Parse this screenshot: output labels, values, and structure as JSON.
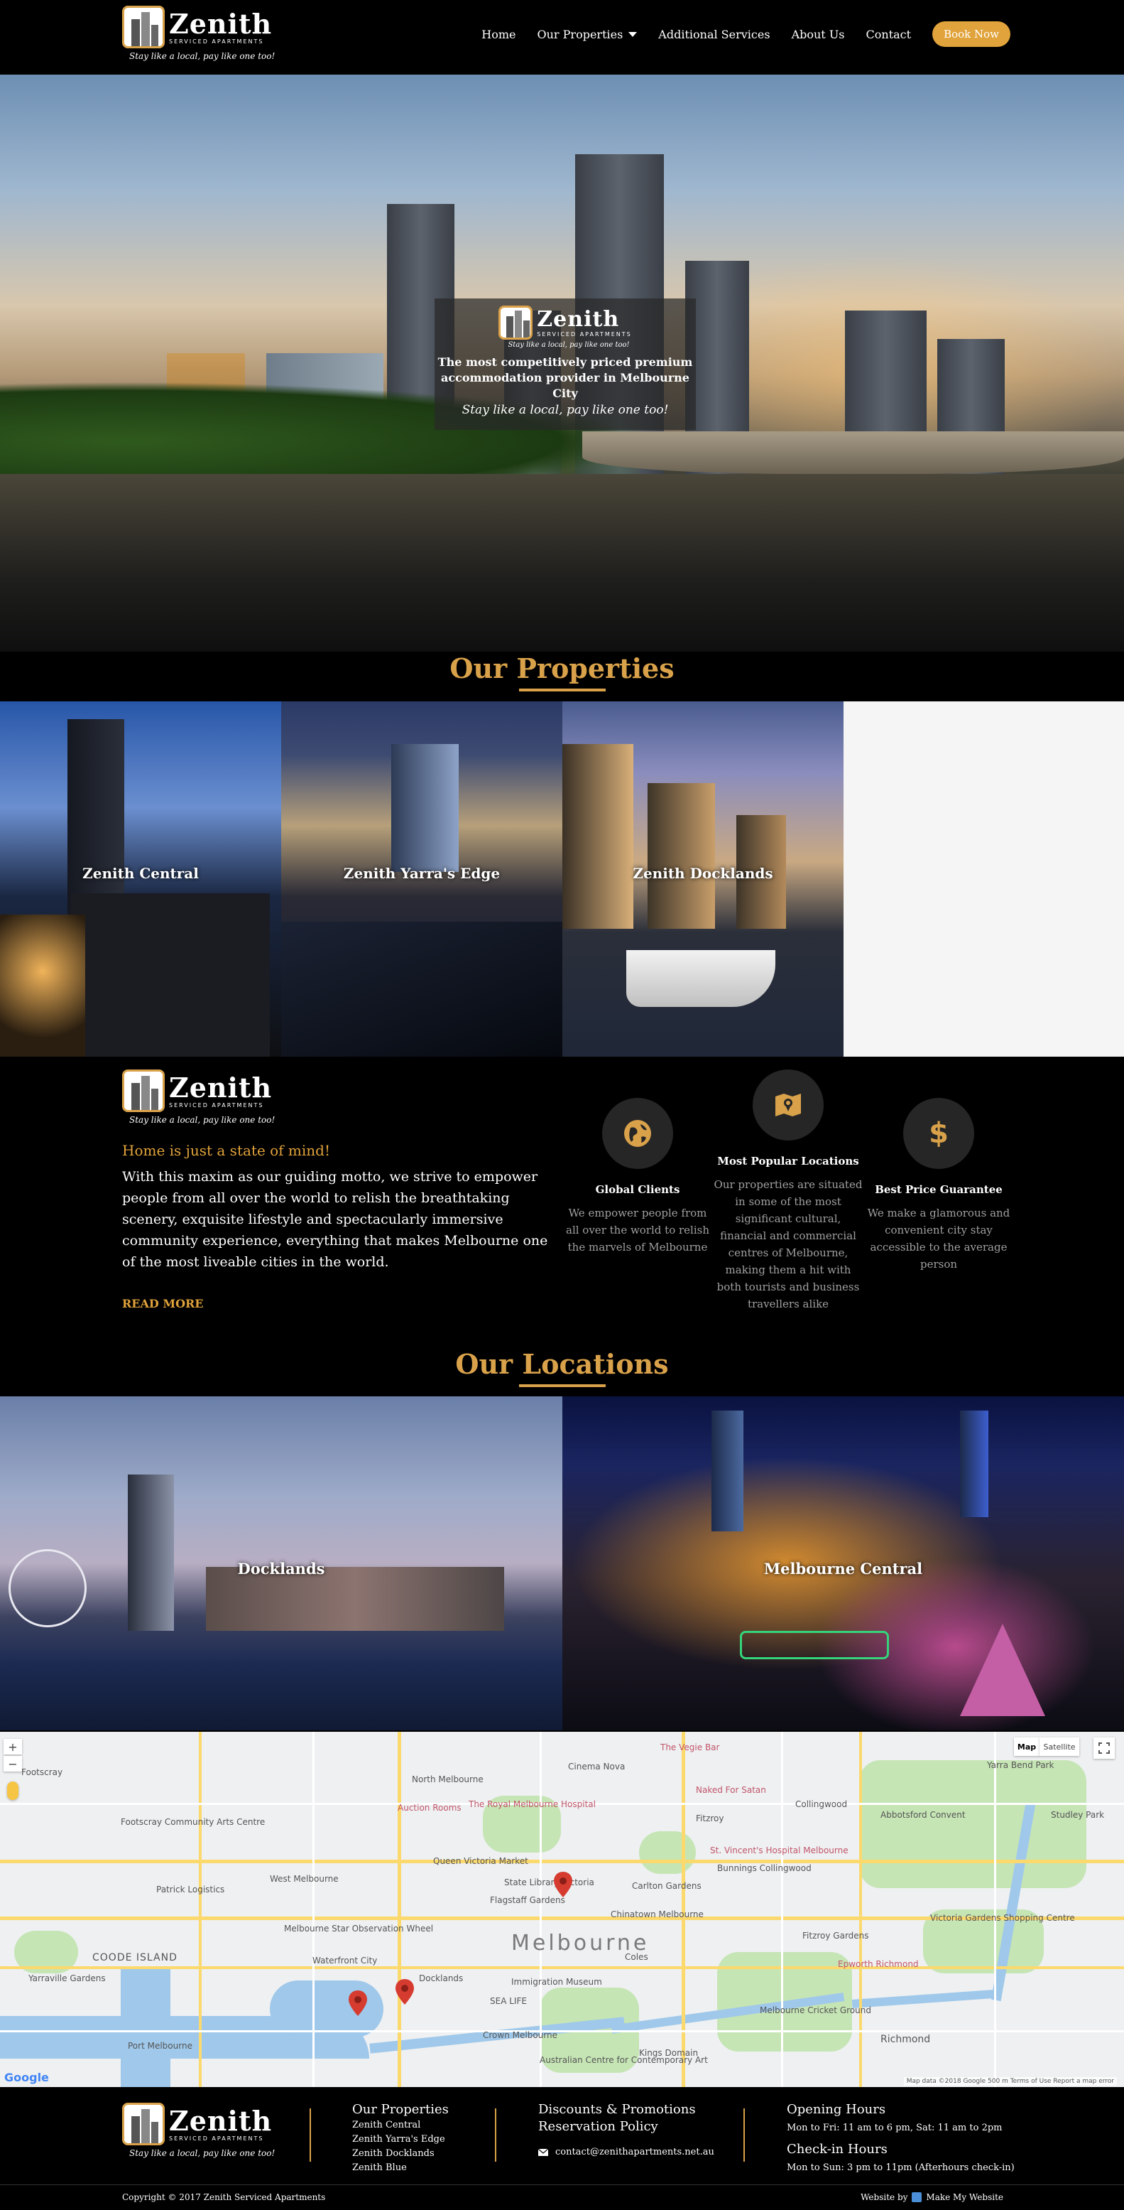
{
  "brand": {
    "name": "Zenith",
    "subtitle": "SERVICED APARTMENTS",
    "tagline": "Stay like a local, pay like one too!"
  },
  "nav": {
    "items": [
      "Home",
      "Our Properties",
      "Additional Services",
      "About Us",
      "Contact"
    ],
    "book_label": "Book Now"
  },
  "hero": {
    "line1": "The most competitively priced premium",
    "line2": "accommodation provider in Melbourne City",
    "tagline": "Stay like a local, pay like one too!"
  },
  "properties": {
    "title": "Our Properties",
    "items": [
      "Zenith Central",
      "Zenith Yarra's Edge",
      "Zenith Docklands"
    ]
  },
  "about": {
    "heading": "Home is just a state of mind!",
    "body": "With this maxim as our guiding motto, we strive to empower people from all over the world to relish the breathtaking scenery, exquisite lifestyle and spectacularly immersive community experience, everything that makes Melbourne one of the most liveable cities in the world.",
    "read_more": "READ MORE"
  },
  "features": [
    {
      "icon": "globe-icon",
      "title": "Global Clients",
      "text": "We empower people from all over the world to relish the marvels of Melbourne"
    },
    {
      "icon": "map-location-icon",
      "title": "Most Popular Locations",
      "text": "Our properties are situated in some of the most significant cultural, financial and commercial centres of Melbourne, making them a hit with both tourists and business travellers alike"
    },
    {
      "icon": "dollar-icon",
      "title": "Best Price Guarantee",
      "text": "We make a glamorous and convenient city stay accessible to the average person"
    }
  ],
  "locations": {
    "title": "Our Locations",
    "items": [
      "Docklands",
      "Melbourne Central"
    ]
  },
  "map": {
    "type_buttons": [
      "Map",
      "Satellite"
    ],
    "big_label": "Melbourne",
    "labels": [
      "Footscray",
      "North Melbourne",
      "Fitzroy",
      "Collingwood",
      "Abbotsford Convent",
      "Yarra Bend Park",
      "Studley Park",
      "West Melbourne",
      "Carlton Gardens",
      "Flagstaff Gardens",
      "Melbourne Star Observation Wheel",
      "Waterfront City",
      "Docklands",
      "COODE ISLAND",
      "Yarraville Gardens",
      "Port Melbourne",
      "Crown Melbourne",
      "SEA LIFE",
      "Immigration Museum",
      "Fitzroy Gardens",
      "Melbourne Cricket Ground",
      "Richmond",
      "Cinema Nova",
      "The Royal Melbourne Hospital",
      "Queen Victoria Market",
      "State Library Victoria",
      "Chinatown Melbourne",
      "Patrick Logistics",
      "Footscray Community Arts Centre",
      "Epworth Richmond",
      "Australian Centre for Contemporary Art",
      "Kings Domain",
      "Victoria Gardens Shopping Centre",
      "Naked For Satan",
      "Bunnings Collingwood",
      "Coles",
      "Auction Rooms",
      "The Vegie Bar",
      "St. Vincent's Hospital Melbourne"
    ],
    "attribution": "Map data ©2018 Google   500 m   Terms of Use   Report a map error",
    "google": "Google"
  },
  "footer": {
    "col1_head": "Our Properties",
    "col1_links": [
      "Zenith Central",
      "Zenith Yarra's Edge",
      "Zenith Docklands",
      "Zenith Blue"
    ],
    "col2_head1": "Discounts & Promotions",
    "col2_head2": "Reservation Policy",
    "email": "contact@zenithapartments.net.au",
    "col3_head1": "Opening Hours",
    "col3_text1": "Mon to Fri: 11 am to 6 pm, Sat: 11 am to 2pm",
    "col3_head2": "Check-in Hours",
    "col3_text2": "Mon to Sun: 3 pm to 11pm (Afterhours check-in)",
    "copyright": "Copyright © 2017 Zenith Serviced Apartments",
    "credit_prefix": "Website by",
    "credit_name": "Make My Website"
  },
  "colors": {
    "accent": "#d9a24a",
    "button": "#e1a33b",
    "background": "#000000"
  }
}
